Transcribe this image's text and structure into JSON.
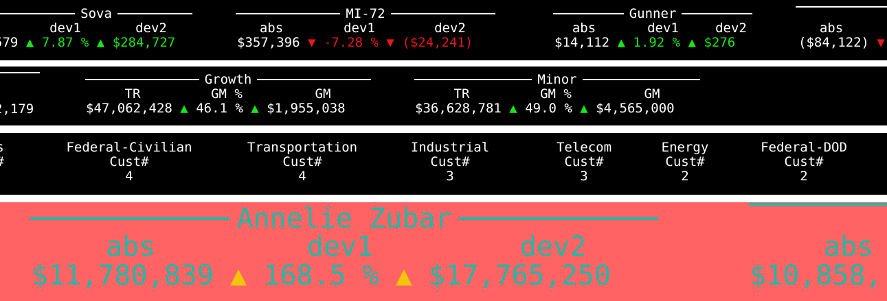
{
  "panel1": {
    "groups": [
      {
        "title": "Sova",
        "labels": [
          "dev1",
          "dev2"
        ],
        "abs_partial": "579",
        "arrow1": "▲",
        "dev1": "7.87 %",
        "arrow2": "▲",
        "dev2": "$284,727",
        "dir": "up"
      },
      {
        "title": "MI-72",
        "labels": [
          "abs",
          "dev1",
          "dev2"
        ],
        "abs": "$357,396",
        "arrow1": "▼",
        "dev1": "-7.28 %",
        "arrow2": "▼",
        "dev2": "($24,241)",
        "dir": "down"
      },
      {
        "title": "Gunner",
        "labels": [
          "abs",
          "dev1",
          "dev2"
        ],
        "abs": "$14,112",
        "arrow1": "▲",
        "dev1": "1.92 %",
        "arrow2": "▲",
        "dev2": "$276",
        "dir": "up"
      },
      {
        "title": "",
        "labels": [
          "abs"
        ],
        "abs": "($84,122)",
        "arrow1": "▼"
      }
    ]
  },
  "panel2": {
    "partial_value": "2,179",
    "groups": [
      {
        "title": "Growth",
        "labels": [
          "TR",
          "GM %",
          "GM"
        ],
        "tr": "$47,062,428",
        "arrow1": "▲",
        "gmp": "46.1 %",
        "arrow2": "▲",
        "gm": "$1,955,038"
      },
      {
        "title": "Minor",
        "labels": [
          "TR",
          "GM %",
          "GM"
        ],
        "tr": "$36,628,781",
        "arrow1": "▲",
        "gmp": "49.0 %",
        "arrow2": "▲",
        "gm": "$4,565,000"
      }
    ]
  },
  "panel3": {
    "partial": {
      "name": "s",
      "sub": "#"
    },
    "sub_label": "Cust#",
    "industries": [
      {
        "name": "Federal-Civilian",
        "count": "4"
      },
      {
        "name": "Transportation",
        "count": "4"
      },
      {
        "name": "Industrial",
        "count": "3"
      },
      {
        "name": "Telecom",
        "count": "3"
      },
      {
        "name": "Energy",
        "count": "2"
      },
      {
        "name": "Federal-DOD",
        "count": "2"
      }
    ]
  },
  "panel4": {
    "title": "Annelie Zubar",
    "labels": [
      "abs",
      "dev1",
      "dev2"
    ],
    "abs": "$11,780,839",
    "arrow1": "▲",
    "dev1": "168.5 %",
    "arrow2": "▲",
    "dev2": "$17,765,250",
    "next_label": "abs",
    "next_value": "$10,858,",
    "colors": {
      "background": "#ff6363",
      "text": "#22b8a8",
      "arrow": "#f2c40a"
    }
  }
}
